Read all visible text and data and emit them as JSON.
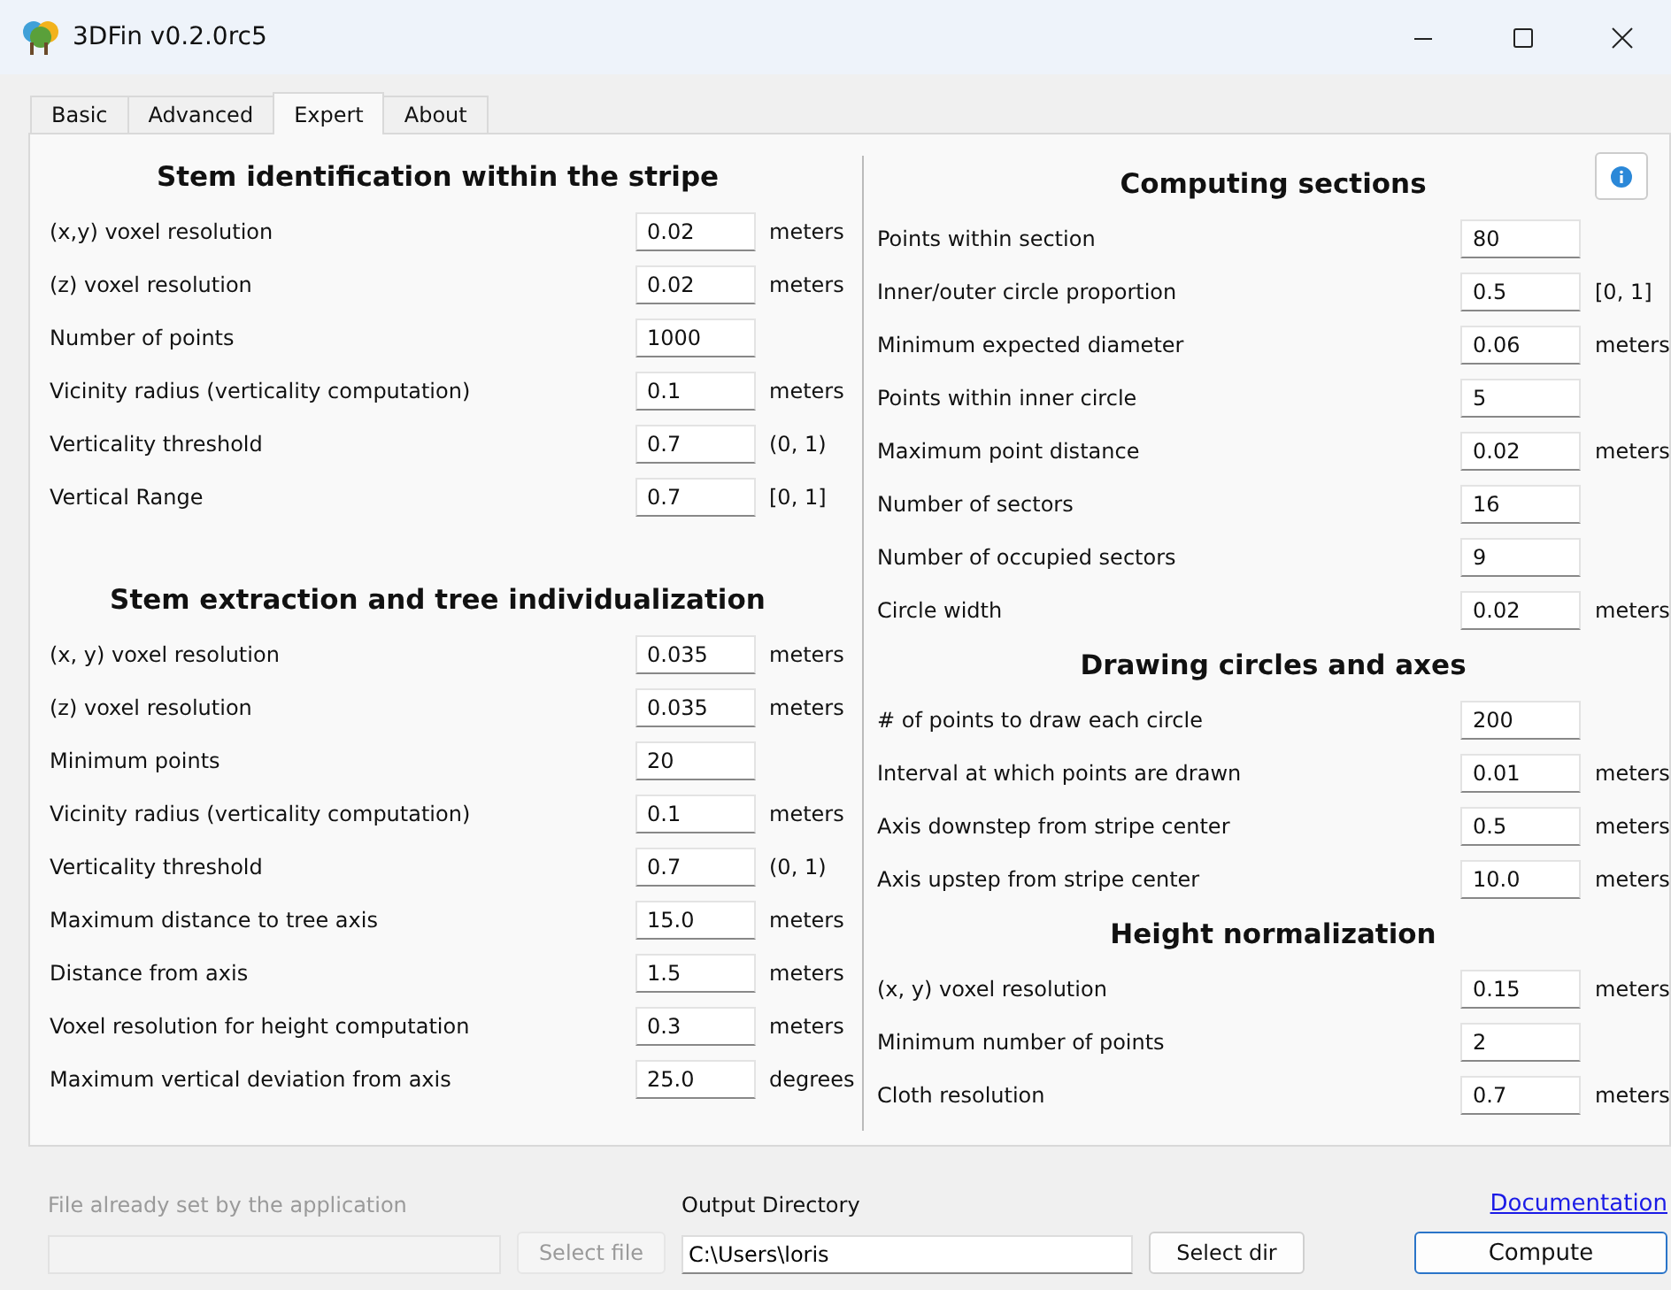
{
  "window": {
    "title": "3DFin v0.2.0rc5"
  },
  "tabs": [
    {
      "label": "Basic",
      "selected": false
    },
    {
      "label": "Advanced",
      "selected": false
    },
    {
      "label": "Expert",
      "selected": true
    },
    {
      "label": "About",
      "selected": false
    }
  ],
  "columns": [
    {
      "sections": [
        {
          "title": "Stem identification within the stripe",
          "rows": [
            {
              "label": "(x,y) voxel resolution",
              "value": "0.02",
              "unit": "meters"
            },
            {
              "label": "(z) voxel resolution",
              "value": "0.02",
              "unit": "meters"
            },
            {
              "label": "Number of points",
              "value": "1000"
            },
            {
              "label": "Vicinity radius (verticality computation)",
              "value": "0.1",
              "unit": "meters"
            },
            {
              "label": "Verticality threshold",
              "value": "0.7",
              "unit": "(0, 1)"
            },
            {
              "label": "Vertical Range",
              "value": "0.7",
              "unit": "[0, 1]"
            }
          ]
        },
        {
          "title": "Stem extraction and tree individualization",
          "rows": [
            {
              "label": "(x, y) voxel resolution",
              "value": "0.035",
              "unit": "meters"
            },
            {
              "label": "(z) voxel resolution",
              "value": "0.035",
              "unit": "meters"
            },
            {
              "label": "Minimum points",
              "value": "20"
            },
            {
              "label": "Vicinity radius (verticality computation)",
              "value": "0.1",
              "unit": "meters"
            },
            {
              "label": "Verticality threshold",
              "value": "0.7",
              "unit": "(0, 1)"
            },
            {
              "label": "Maximum distance to tree axis",
              "value": "15.0",
              "unit": "meters"
            },
            {
              "label": "Distance from axis",
              "value": "1.5",
              "unit": "meters"
            },
            {
              "label": "Voxel resolution for height computation",
              "value": "0.3",
              "unit": "meters"
            },
            {
              "label": "Maximum vertical deviation from axis",
              "value": "25.0",
              "unit": "degrees"
            }
          ]
        }
      ]
    },
    {
      "sections": [
        {
          "title": "Computing sections",
          "info_button": true,
          "rows": [
            {
              "label": "Points within section",
              "value": "80"
            },
            {
              "label": "Inner/outer circle proportion",
              "value": "0.5",
              "unit": "[0, 1]"
            },
            {
              "label": "Minimum expected diameter",
              "value": "0.06",
              "unit": "meters"
            },
            {
              "label": "Points within inner circle",
              "value": "5"
            },
            {
              "label": "Maximum point distance",
              "value": "0.02",
              "unit": "meters"
            },
            {
              "label": "Number of sectors",
              "value": "16"
            },
            {
              "label": "Number of occupied sectors",
              "value": "9"
            },
            {
              "label": "Circle width",
              "value": "0.02",
              "unit": "meters"
            }
          ]
        },
        {
          "title": "Drawing circles and axes",
          "rows": [
            {
              "label": "# of points to draw each circle",
              "value": "200"
            },
            {
              "label": "Interval at which points are drawn",
              "value": "0.01",
              "unit": "meters"
            },
            {
              "label": "Axis downstep from stripe center",
              "value": "0.5",
              "unit": "meters"
            },
            {
              "label": "Axis upstep from stripe center",
              "value": "10.0",
              "unit": "meters"
            }
          ]
        },
        {
          "title": "Height normalization",
          "rows": [
            {
              "label": "(x, y) voxel resolution",
              "value": "0.15",
              "unit": "meters"
            },
            {
              "label": "Minimum number of points",
              "value": "2"
            },
            {
              "label": "Cloth resolution",
              "value": "0.7",
              "unit": "meters"
            }
          ]
        }
      ]
    }
  ],
  "footer": {
    "file": {
      "label": "File already set by the application",
      "button": "Select file",
      "disabled": true
    },
    "output": {
      "label": "Output Directory",
      "value": "C:\\Users\\loris",
      "button": "Select dir"
    },
    "documentation_link": "Documentation",
    "compute_button": {
      "label": "Compute",
      "focused": true
    }
  }
}
